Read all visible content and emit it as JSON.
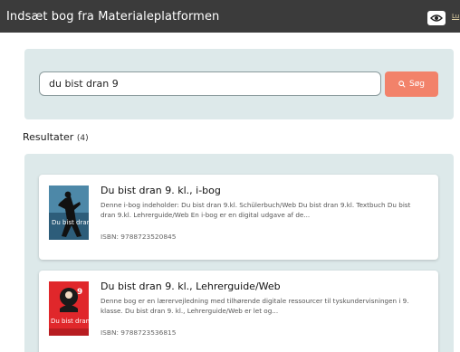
{
  "header": {
    "title": "Indsæt bog fra Materialeplatformen",
    "close_label": "Lu"
  },
  "search": {
    "value": "du bist dran 9",
    "button_label": "Søg"
  },
  "results": {
    "heading": "Resultater",
    "count": "(4)",
    "items": [
      {
        "title": "Du bist dran 9. kl., i-bog",
        "description": "Denne i-bog indeholder: Du bist dran 9.kl. Schülerbuch/Web Du bist dran 9.kl. Textbuch Du bist dran 9.kl. Lehrerguide/Web En i-bog er en digital udgave af de...",
        "isbn": "ISBN: 9788723520845",
        "cover_text": "Du bist dran"
      },
      {
        "title": "Du bist dran 9. kl., Lehrerguide/Web",
        "description": "Denne bog er en lærervejledning med tilhørende digitale ressourcer til tyskundervisningen i 9. klasse. Du bist dran 9. kl., Lehrerguide/Web er let og...",
        "isbn": "ISBN: 9788723536815",
        "cover_text": "Du bist dran",
        "cover_badge": "9"
      }
    ]
  },
  "colors": {
    "header_bg": "#3b3b3b",
    "panel_bg": "#dde9ea",
    "accent": "#f2826a"
  }
}
